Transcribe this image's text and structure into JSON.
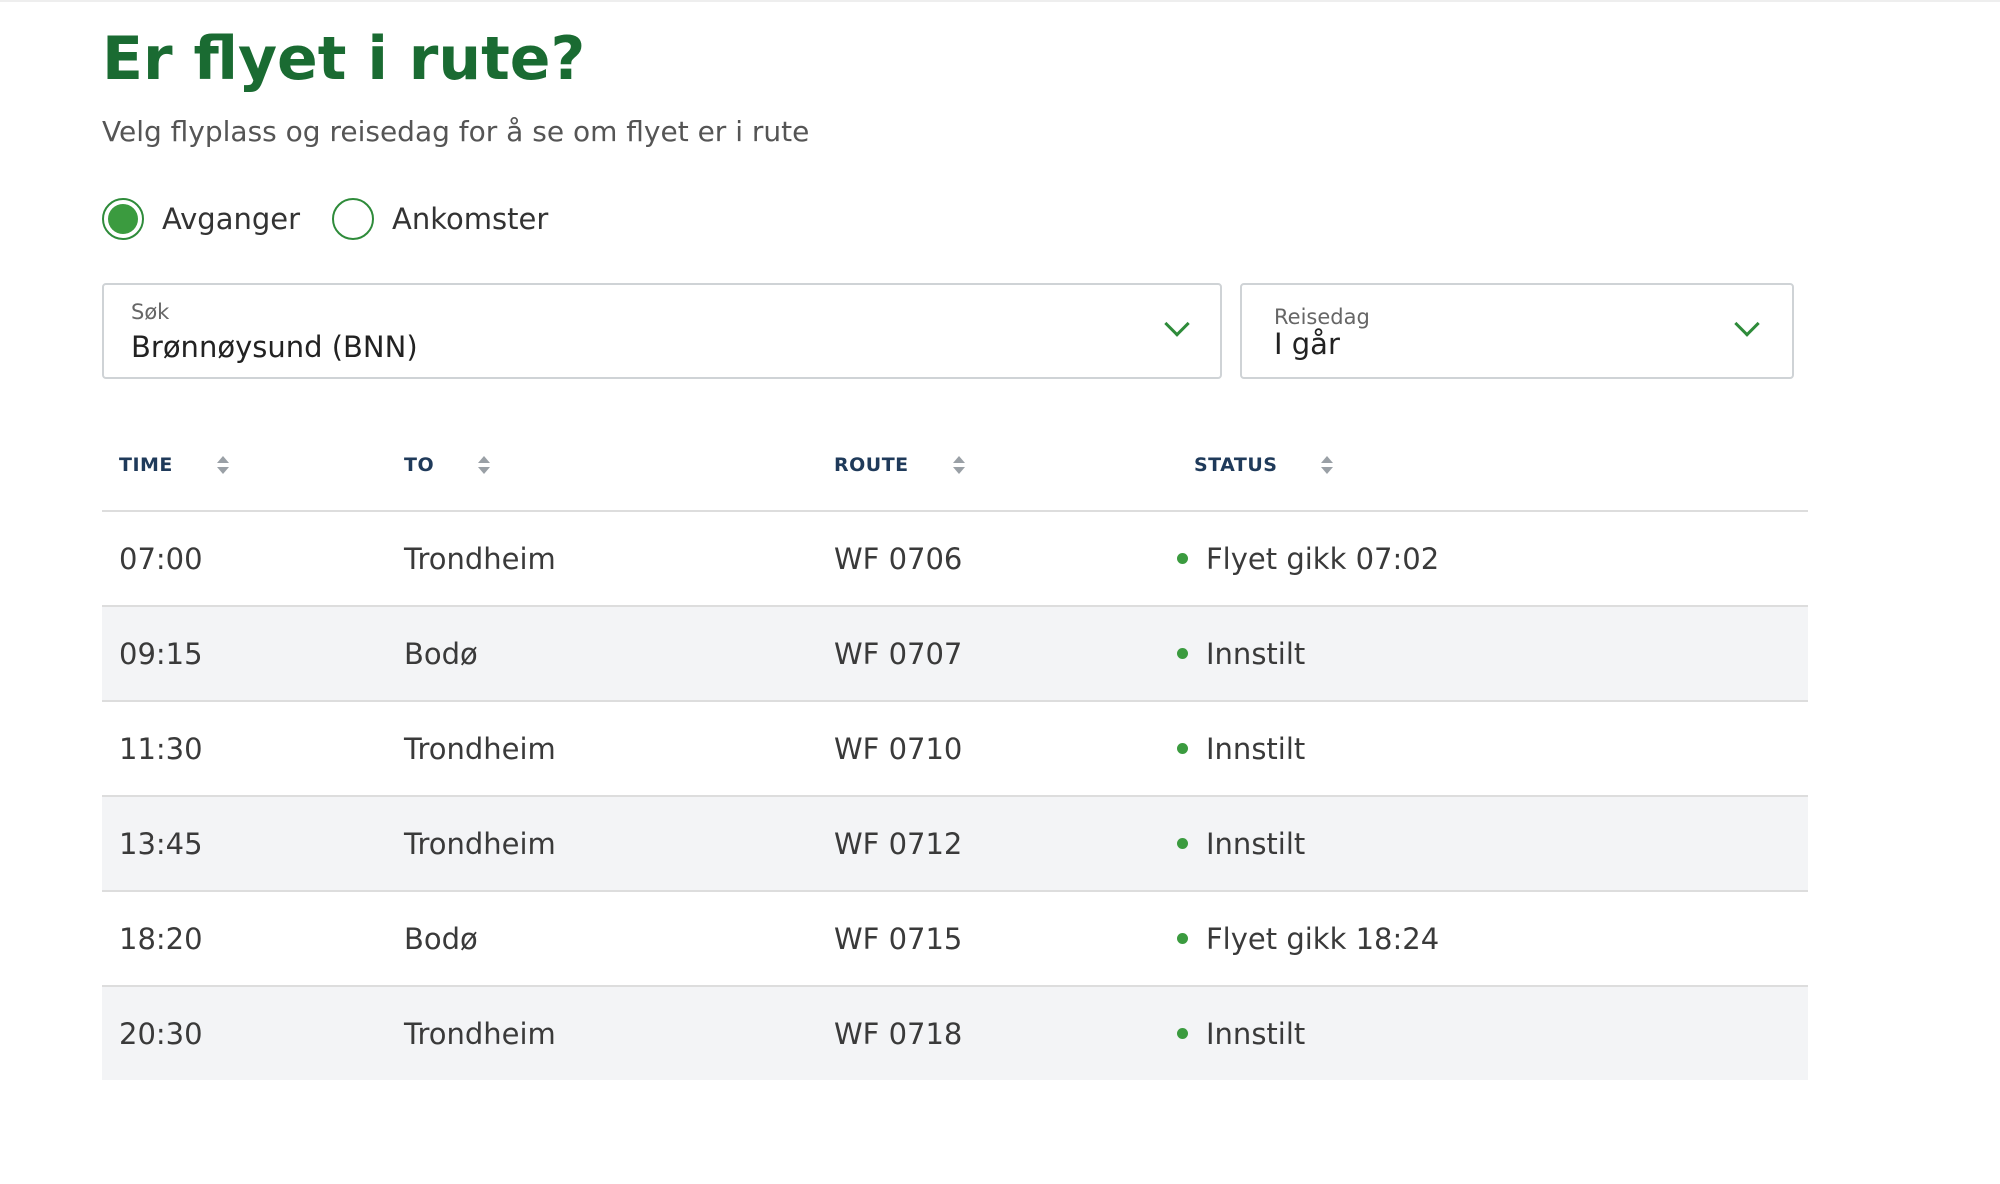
{
  "header": {
    "title": "Er flyet i rute?",
    "subtitle": "Velg flyplass og reisedag for å se om flyet er i rute"
  },
  "direction": {
    "selected": "Avganger",
    "options": [
      "Avganger",
      "Ankomster"
    ]
  },
  "search": {
    "label": "Søk",
    "value": "Brønnøysund (BNN)"
  },
  "date": {
    "label": "Reisedag",
    "value": "I går"
  },
  "table": {
    "headers": {
      "time": "TIME",
      "to": "TO",
      "route": "ROUTE",
      "status": "STATUS"
    },
    "rows": [
      {
        "time": "07:00",
        "to": "Trondheim",
        "route": "WF 0706",
        "status": "Flyet gikk 07:02"
      },
      {
        "time": "09:15",
        "to": "Bodø",
        "route": "WF 0707",
        "status": "Innstilt"
      },
      {
        "time": "11:30",
        "to": "Trondheim",
        "route": "WF 0710",
        "status": "Innstilt"
      },
      {
        "time": "13:45",
        "to": "Trondheim",
        "route": "WF 0712",
        "status": "Innstilt"
      },
      {
        "time": "18:20",
        "to": "Bodø",
        "route": "WF 0715",
        "status": "Flyet gikk 18:24"
      },
      {
        "time": "20:30",
        "to": "Trondheim",
        "route": "WF 0718",
        "status": "Innstilt"
      }
    ]
  },
  "colors": {
    "brand_green": "#1a6b32",
    "status_dot": "#3b9b3f",
    "row_alt": "#f3f4f6"
  }
}
